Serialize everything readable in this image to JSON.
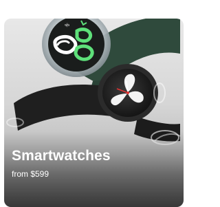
{
  "card": {
    "title": "Smartwatches",
    "price_text": "from $599"
  },
  "colors": {
    "card_background": "#d9d9d9",
    "watch_green_strap": "#2f4a3c",
    "watch_black_strap": "#1f1f1f",
    "watch_face_accent": "#5ee07a",
    "text": "#ffffff"
  },
  "icons": {
    "product_image": "smartwatches-image"
  }
}
